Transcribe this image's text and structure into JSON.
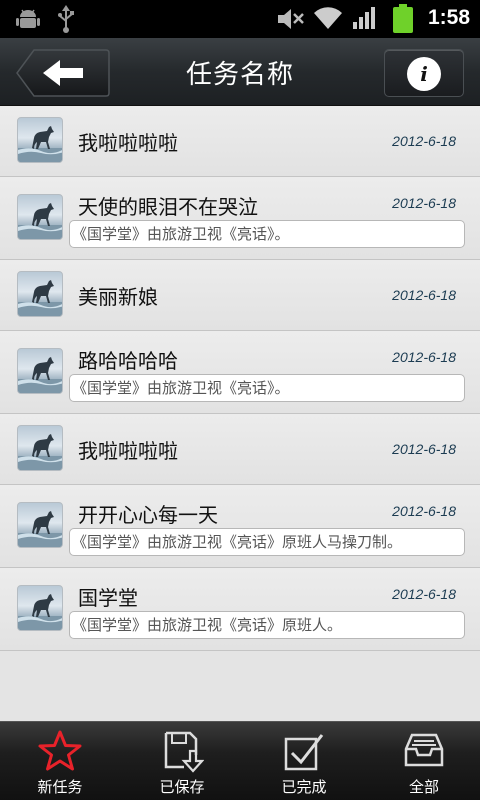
{
  "status_bar": {
    "time": "1:58",
    "icons": [
      "android-debug-icon",
      "usb-icon",
      "mute-icon",
      "wifi-icon",
      "signal-icon",
      "battery-icon"
    ],
    "battery_color": "#6fd12a"
  },
  "header": {
    "title": "任务名称",
    "back_icon": "back-arrow-icon",
    "info_icon": "info-icon",
    "info_label": "i"
  },
  "tasks": [
    {
      "name": "我啦啦啦啦",
      "date": "2012-6-18",
      "desc": ""
    },
    {
      "name": "天使的眼泪不在哭泣",
      "date": "2012-6-18",
      "desc": "《国学堂》由旅游卫视《亮话》。"
    },
    {
      "name": "美丽新娘",
      "date": "2012-6-18",
      "desc": ""
    },
    {
      "name": "路哈哈哈哈",
      "date": "2012-6-18",
      "desc": "《国学堂》由旅游卫视《亮话》。"
    },
    {
      "name": "我啦啦啦啦",
      "date": "2012-6-18",
      "desc": ""
    },
    {
      "name": "开开心心每一天",
      "date": "2012-6-18",
      "desc": "《国学堂》由旅游卫视《亮话》原班人马操刀制。"
    },
    {
      "name": "国学堂",
      "date": "2012-6-18",
      "desc": "《国学堂》由旅游卫视《亮话》原班人。"
    }
  ],
  "tabs": [
    {
      "label": "新任务",
      "icon": "star-icon",
      "active": true
    },
    {
      "label": "已保存",
      "icon": "save-icon",
      "active": false
    },
    {
      "label": "已完成",
      "icon": "checkbox-icon",
      "active": false
    },
    {
      "label": "全部",
      "icon": "inbox-tray-icon",
      "active": false
    }
  ],
  "colors": {
    "accent": "#e8222a",
    "date_text": "#1c3c52",
    "title_bar": "#25292c"
  }
}
